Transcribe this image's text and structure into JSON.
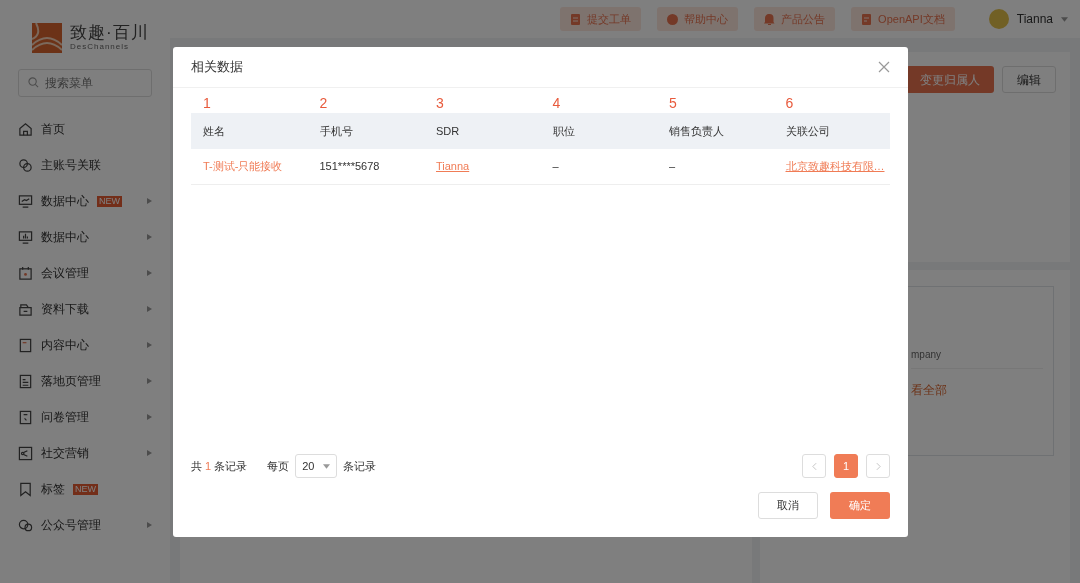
{
  "sidebar": {
    "logo": {
      "name": "致趣·百川",
      "tagline": "DesChannels"
    },
    "search": {
      "placeholder": "搜索菜单"
    },
    "items": [
      {
        "label": "首页",
        "has_submenu": false
      },
      {
        "label": "主账号关联",
        "has_submenu": false
      },
      {
        "label": "数据中心",
        "badge": "NEW",
        "has_submenu": true
      },
      {
        "label": "数据中心",
        "has_submenu": true
      },
      {
        "label": "会议管理",
        "has_submenu": true
      },
      {
        "label": "资料下载",
        "has_submenu": true
      },
      {
        "label": "内容中心",
        "has_submenu": true
      },
      {
        "label": "落地页管理",
        "has_submenu": true
      },
      {
        "label": "问卷管理",
        "has_submenu": true
      },
      {
        "label": "社交营销",
        "has_submenu": true
      },
      {
        "label": "标签",
        "badge": "NEW",
        "has_submenu": false
      },
      {
        "label": "公众号管理",
        "has_submenu": true
      }
    ]
  },
  "header": {
    "buttons": [
      {
        "label": "提交工单"
      },
      {
        "label": "帮助中心"
      },
      {
        "label": "产品公告"
      },
      {
        "label": "OpenAPI文档"
      }
    ],
    "user": {
      "name": "Tianna"
    }
  },
  "page_actions": [
    {
      "label": "变更归属人",
      "kind": "primary"
    },
    {
      "label": "编辑",
      "kind": "default"
    }
  ],
  "background_texts": {
    "field": "mpany",
    "link": "看全部"
  },
  "modal": {
    "title": "相关数据",
    "columns": [
      {
        "number": "1",
        "label": "姓名"
      },
      {
        "number": "2",
        "label": "手机号"
      },
      {
        "number": "3",
        "label": "SDR"
      },
      {
        "number": "4",
        "label": "职位"
      },
      {
        "number": "5",
        "label": "销售负责人"
      },
      {
        "number": "6",
        "label": "关联公司"
      }
    ],
    "rows": [
      {
        "cells": [
          {
            "text": "T-测试-只能接收",
            "kind": "accent"
          },
          {
            "text": "151****5678",
            "kind": "plain"
          },
          {
            "text": "Tianna",
            "kind": "link"
          },
          {
            "text": "–",
            "kind": "plain"
          },
          {
            "text": "–",
            "kind": "plain"
          },
          {
            "text": "北京致趣科技有限…",
            "kind": "link"
          }
        ]
      }
    ],
    "pagination": {
      "total_prefix": "共",
      "total": "1",
      "total_suffix": "条记录",
      "per_page_label": "每页",
      "per_page": "20",
      "per_page_suffix": "条记录",
      "pages": [
        {
          "label": "1",
          "selected": true
        }
      ]
    },
    "buttons": [
      {
        "label": "取消",
        "kind": "default"
      },
      {
        "label": "确定",
        "kind": "primary"
      }
    ]
  }
}
